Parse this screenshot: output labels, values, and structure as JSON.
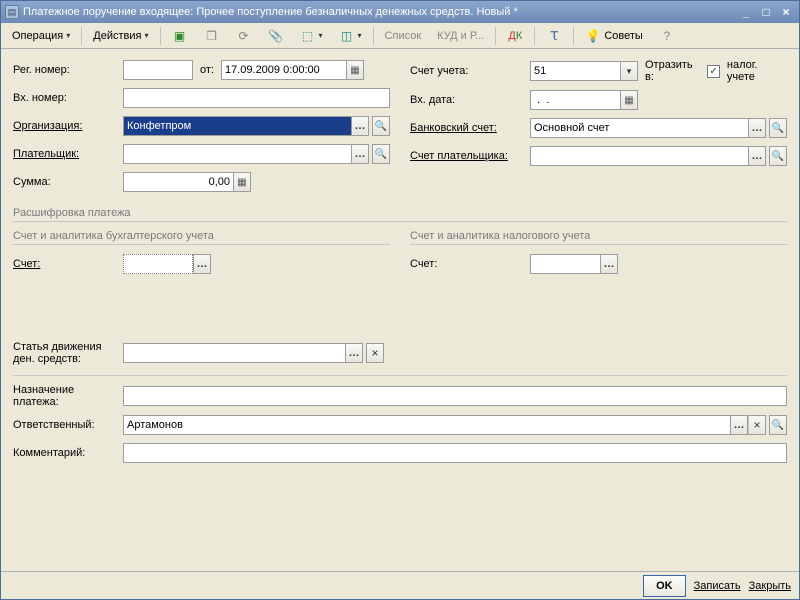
{
  "titlebar": {
    "title": "Платежное поручение входящее: Прочее поступление безналичных денежных средств. Новый *"
  },
  "toolbar": {
    "operation": "Операция",
    "actions": "Действия",
    "list": "Список",
    "kudir": "КУД и Р...",
    "tips": "Советы"
  },
  "left": {
    "reg_no_label": "Рег. номер:",
    "reg_no_value": "",
    "from_label": "от:",
    "date_value": "17.09.2009 0:00:00",
    "in_no_label": "Вх. номер:",
    "in_no_value": "",
    "org_label": "Организация:",
    "org_value": "Конфетпром",
    "payer_label": "Плательщик:",
    "payer_value": "",
    "sum_label": "Сумма:",
    "sum_value": "0,00"
  },
  "right": {
    "account_label": "Счет учета:",
    "account_value": "51",
    "reflect_label": "Отразить в:",
    "tax_label": "налог. учете",
    "in_date_label": "Вх. дата:",
    "in_date_value": " .  .",
    "bank_label": "Банковский счет:",
    "bank_value": "Основной счет",
    "payer_acc_label": "Счет плательщика:",
    "payer_acc_value": ""
  },
  "sections": {
    "breakdown": "Расшифровка платежа",
    "acc_analytics": "Счет и аналитика бухгалтерского учета",
    "tax_analytics": "Счет и аналитика налогового учета",
    "schet_label": "Счет:"
  },
  "movement": {
    "label": "Статья движения ден. средств:",
    "label_l1": "Статья движения",
    "label_l2": "ден. средств:"
  },
  "bottom_fields": {
    "purpose_label_l1": "Назначение",
    "purpose_label_l2": "платежа:",
    "purpose_value": "",
    "responsible_label": "Ответственный:",
    "responsible_value": "Артамонов",
    "comment_label": "Комментарий:",
    "comment_value": ""
  },
  "buttons": {
    "ok": "OK",
    "save": "Записать",
    "close": "Закрыть"
  }
}
